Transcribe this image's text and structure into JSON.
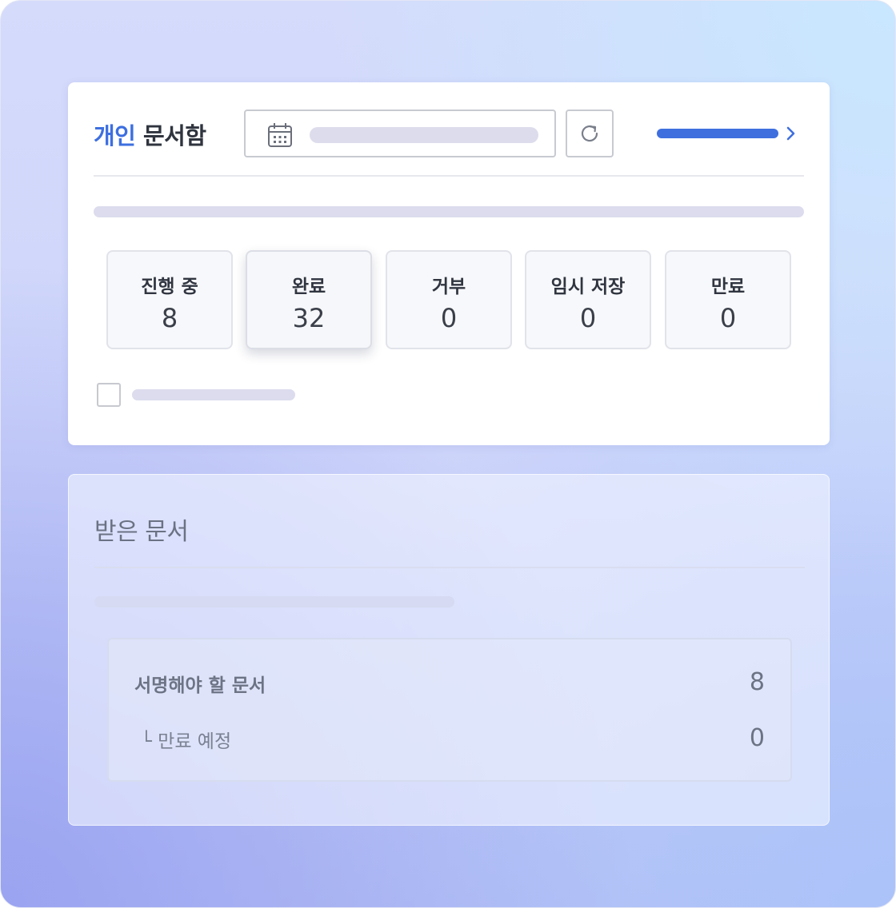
{
  "header": {
    "title_accent": "개인",
    "title_rest": " 문서함"
  },
  "stats": [
    {
      "label": "진행 중",
      "value": "8"
    },
    {
      "label": "완료",
      "value": "32"
    },
    {
      "label": "거부",
      "value": "0"
    },
    {
      "label": "임시 저장",
      "value": "0"
    },
    {
      "label": "만료",
      "value": "0"
    }
  ],
  "received": {
    "title": "받은 문서",
    "rows": [
      {
        "label": "서명해야 할 문서",
        "value": "8"
      },
      {
        "label": "└ 만료 예정",
        "value": "0"
      }
    ]
  },
  "colors": {
    "accent": "#3d6fe0",
    "skeleton": "#dcdcee"
  },
  "icons": [
    "calendar-icon",
    "refresh-icon",
    "chevron-right-icon"
  ]
}
